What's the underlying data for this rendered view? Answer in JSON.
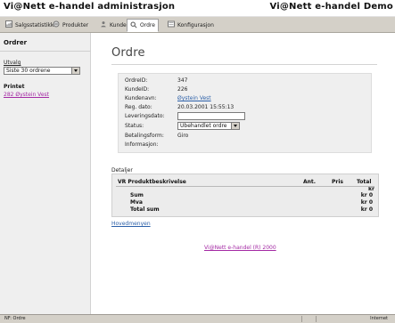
{
  "header": {
    "left_title": "Vi@Nett e-handel administrasjon",
    "right_title": "Vi@Nett e-handel Demo"
  },
  "toolbar": {
    "items": [
      {
        "label": "Salgsstatistikk",
        "icon": "chart-icon"
      },
      {
        "label": "Produkter",
        "icon": "product-icon"
      },
      {
        "label": "Kunder",
        "icon": "user-icon"
      },
      {
        "label": "Ordre",
        "icon": "search-icon"
      },
      {
        "label": "Konfigurasjon",
        "icon": "wrench-icon"
      }
    ]
  },
  "sidebar": {
    "title": "Ordrer",
    "utvalg_label": "Utvalg",
    "utvalg_value": "Siste 30 ordrene",
    "printed_label": "Printet",
    "printed_link": "282 Øystein Vest"
  },
  "main": {
    "title": "Ordre",
    "fields": [
      {
        "label": "OrdreID:",
        "value": "347",
        "type": "text"
      },
      {
        "label": "KundeID:",
        "value": "226",
        "type": "text"
      },
      {
        "label": "Kundenavn:",
        "value": "Øystein Vest",
        "type": "link"
      },
      {
        "label": "Reg. dato:",
        "value": "20.03.2001 15:55:13",
        "type": "text"
      },
      {
        "label": "Leveringsdato:",
        "value": "",
        "type": "input"
      },
      {
        "label": "Status:",
        "value": "Ubehandlet ordre",
        "type": "select"
      },
      {
        "label": "Betalingsform:",
        "value": "Giro",
        "type": "text"
      },
      {
        "label": "Informasjon:",
        "value": "",
        "type": "text"
      }
    ],
    "details": {
      "label": "Detaljer",
      "columns": [
        "VR Produktbeskrivelse",
        "Ant.",
        "Pris",
        "Total"
      ],
      "currency": "kr",
      "summary": [
        {
          "label": "Sum",
          "value": "kr 0"
        },
        {
          "label": "Mva",
          "value": "kr 0"
        },
        {
          "label": "Total sum",
          "value": "kr 0"
        }
      ]
    },
    "back_link": "Hovedmenyen",
    "footer_link": "Vi@Nett e-handel (R) 2000"
  },
  "statusbar": {
    "left": "NF: Ordre",
    "right": "Internet"
  },
  "colors": {
    "toolbar_bg": "#d4d0c8",
    "sidebar_bg": "#efefef",
    "panel_bg": "#efefef",
    "link_blue": "#2b5fa8",
    "link_purple": "#a42aa4"
  }
}
